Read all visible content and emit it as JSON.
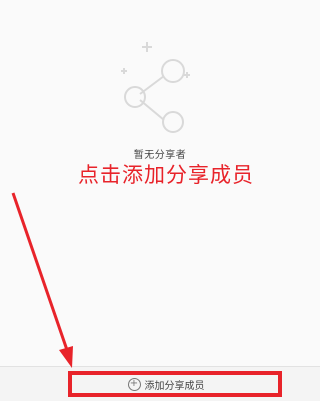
{
  "empty_state": {
    "icon": "share-icon",
    "message": "暂无分享者"
  },
  "annotation": {
    "text": "点击添加分享成员",
    "color": "#e8232a"
  },
  "bottom_bar": {
    "add_button": {
      "icon": "plus-circle-icon",
      "icon_glyph": "+",
      "label": "添加分享成员"
    }
  }
}
